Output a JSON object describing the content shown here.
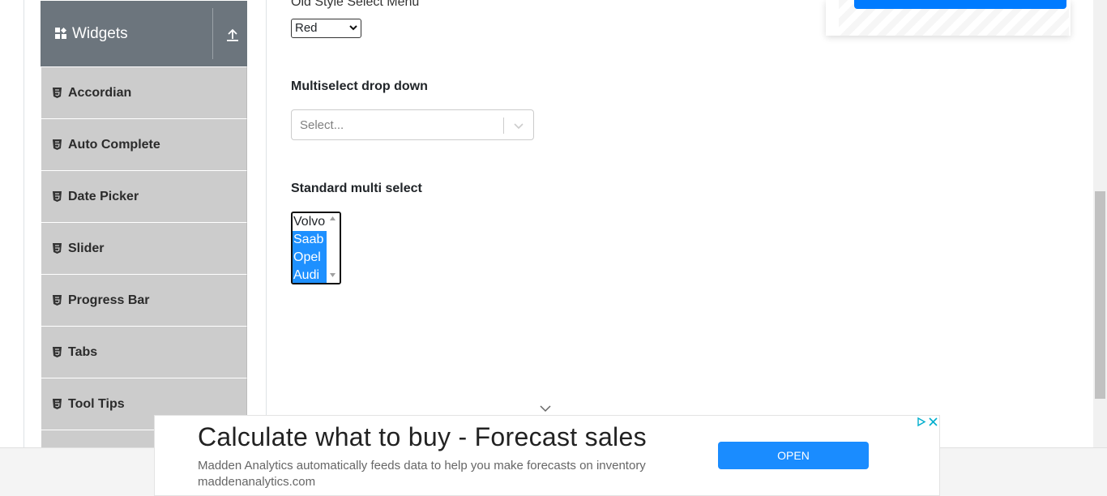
{
  "sidebar": {
    "group_title": "Widgets",
    "items": [
      {
        "label": "Accordian"
      },
      {
        "label": "Auto Complete"
      },
      {
        "label": "Date Picker"
      },
      {
        "label": "Slider"
      },
      {
        "label": "Progress Bar"
      },
      {
        "label": "Tabs"
      },
      {
        "label": "Tool Tips"
      }
    ]
  },
  "old_select": {
    "label": "Old Style Select Menu",
    "value": "Red"
  },
  "multiselect": {
    "label": "Multiselect drop down",
    "placeholder": "Select..."
  },
  "standard_multi": {
    "label": "Standard multi select",
    "options": [
      {
        "label": "Volvo",
        "selected": false
      },
      {
        "label": "Saab",
        "selected": true
      },
      {
        "label": "Opel",
        "selected": true
      },
      {
        "label": "Audi",
        "selected": true
      }
    ]
  },
  "ad": {
    "headline": "Calculate what to buy - Forecast sales",
    "description": "Madden Analytics automatically feeds data to help you make forecasts on inventory",
    "domain": "maddenanalytics.com",
    "cta": "OPEN"
  },
  "colors": {
    "sidebar_header": "#6c757d",
    "sidebar_item": "#cccccc",
    "selected_option": "#1e90ff",
    "ad_button": "#1a8cff"
  }
}
